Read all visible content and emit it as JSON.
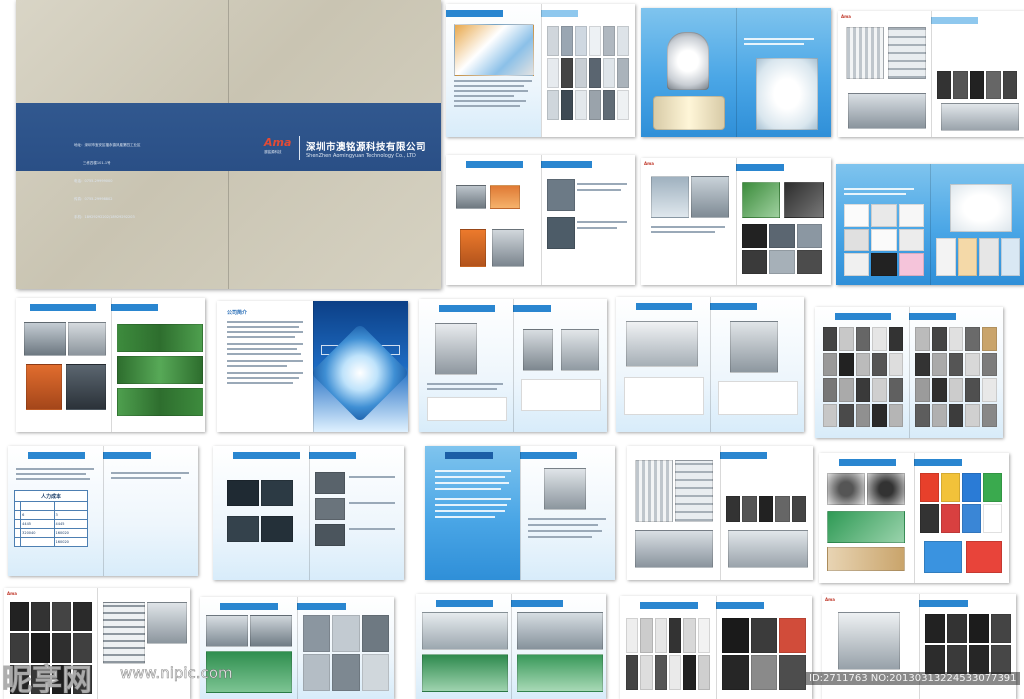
{
  "cover": {
    "brand_logo": "Ama",
    "brand_sub": "澳铭源科技",
    "company_cn": "深圳市澳铭源科技有限公司",
    "company_en": "ShenZhen Aomingyuan Technology Co., LTD",
    "contact_lines": [
      "地址：深圳市宝安区福永镇凤凰第四工业区",
      "        三栋四楼101-1号",
      "电话：0755-29999000",
      "传真：0755-29998802",
      "手机：18929292202/18929292203"
    ]
  },
  "pages": {
    "company_intro_title": "公司简介",
    "intro_slogan": "以质量求发展 以信誉求生存",
    "cost_table": {
      "title": "人力成本",
      "rows": [
        [
          "",
          "",
          ""
        ],
        [
          "",
          "6",
          "3"
        ],
        [
          "",
          "4445",
          "4445"
        ],
        [
          "",
          "320040",
          "160020"
        ],
        [
          "",
          "",
          "160020"
        ]
      ]
    }
  },
  "watermark": {
    "site_name": "昵享网",
    "site_url": "www.nipic.com",
    "image_id": "ID:2711763 NO:20130313224533077391"
  }
}
